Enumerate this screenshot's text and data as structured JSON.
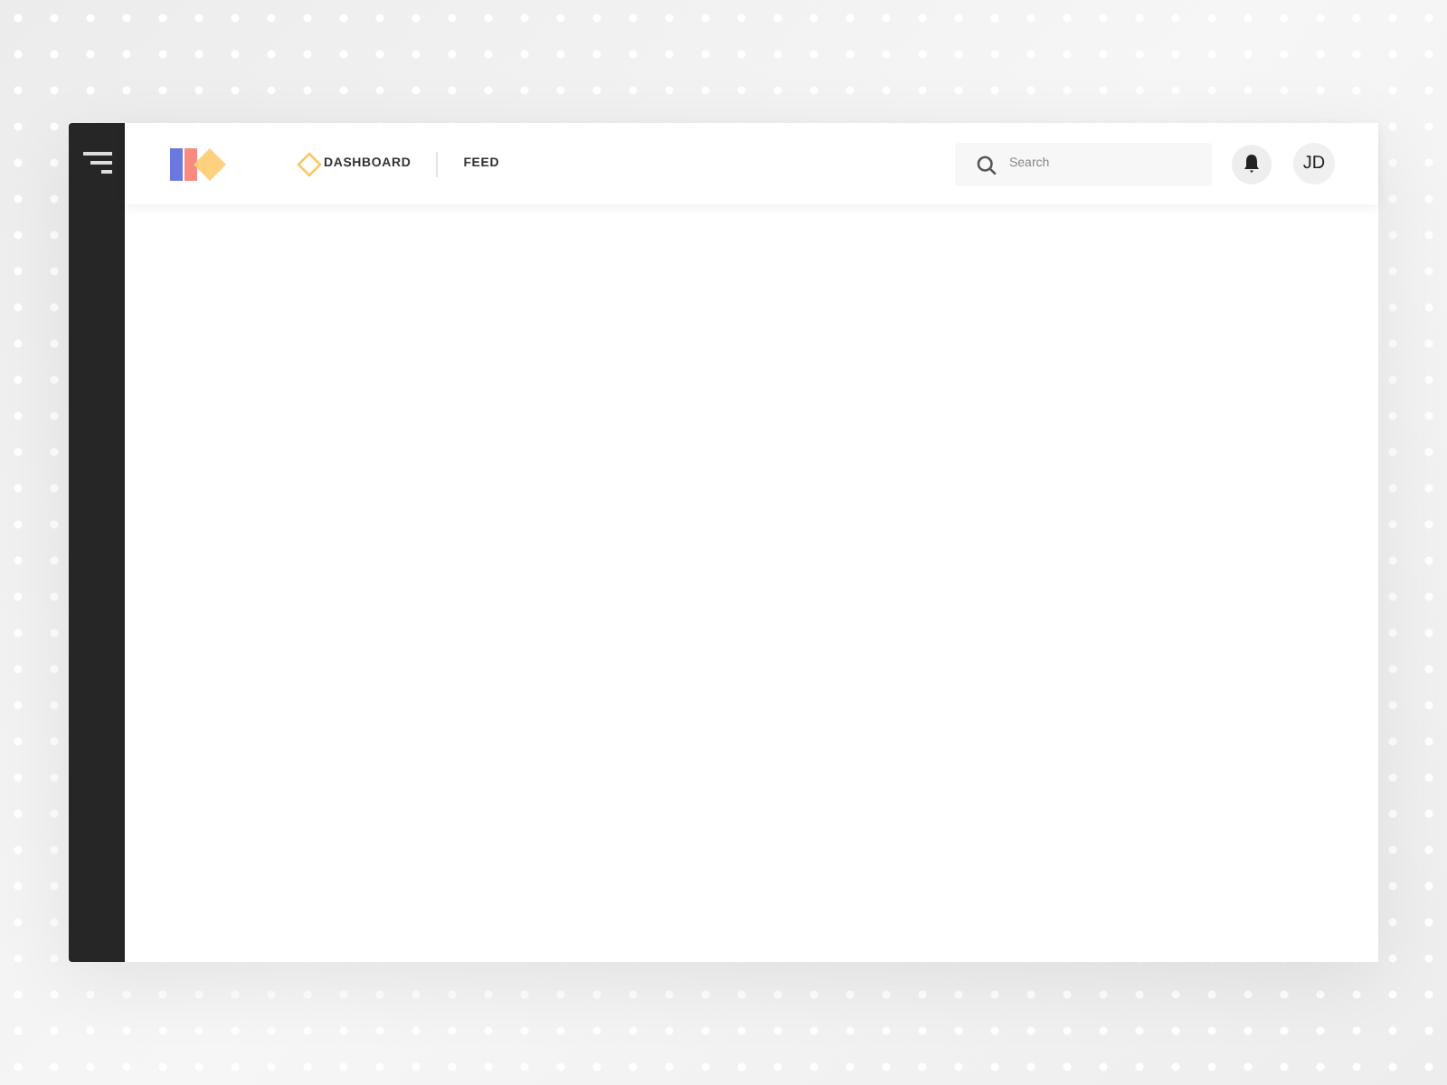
{
  "nav": [
    {
      "label": "DASHBOARD",
      "selected": true
    },
    {
      "label": "FEED",
      "selected": false
    }
  ],
  "search": {
    "placeholder": "Search"
  },
  "user": {
    "initials": "JD"
  }
}
